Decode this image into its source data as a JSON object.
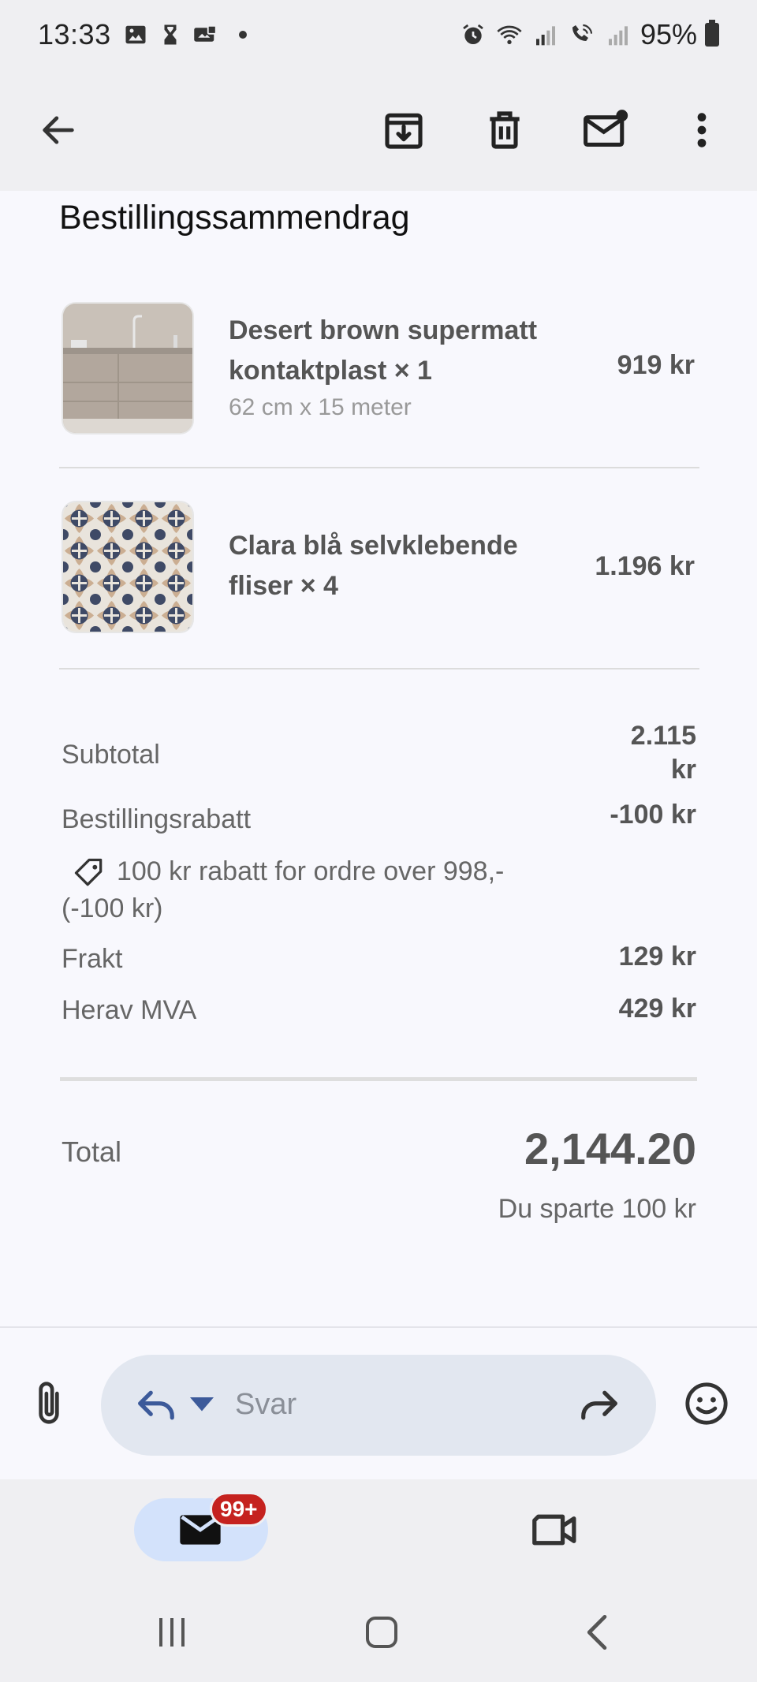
{
  "status": {
    "time": "13:33",
    "battery": "95%"
  },
  "toolbar": {
    "back": "back-arrow-icon",
    "archive": "archive-icon",
    "delete": "delete-icon",
    "mark_unread": "mark-unread-icon",
    "more": "more-vert-icon"
  },
  "summary": {
    "title": "Bestillingssammendrag",
    "items": [
      {
        "name": "Desert brown supermatt kontaktplast × 1",
        "variant": "62 cm x 15 meter",
        "price": "919 kr"
      },
      {
        "name": "Clara blå selvklebende fliser × 4",
        "variant": "",
        "price": "1.196 kr"
      }
    ],
    "subtotal_label": "Subtotal",
    "subtotal_value": "2.115 kr",
    "discount_label": "Bestillingsrabatt",
    "discount_value": "-100 kr",
    "discount_detail": "100 kr rabatt for ordre over 998,- (-100 kr)",
    "shipping_label": "Frakt",
    "shipping_value": "129 kr",
    "vat_label": "Herav MVA",
    "vat_value": "429 kr",
    "total_label": "Total",
    "total_value": "2,144.20",
    "saved_text": "Du sparte 100 kr"
  },
  "reply": {
    "placeholder": "Svar"
  },
  "nav": {
    "mail_badge": "99+"
  },
  "colors": {
    "accent": "#3c5a9a",
    "badge": "#c5221f",
    "mail_pill": "#d3e2fb"
  }
}
